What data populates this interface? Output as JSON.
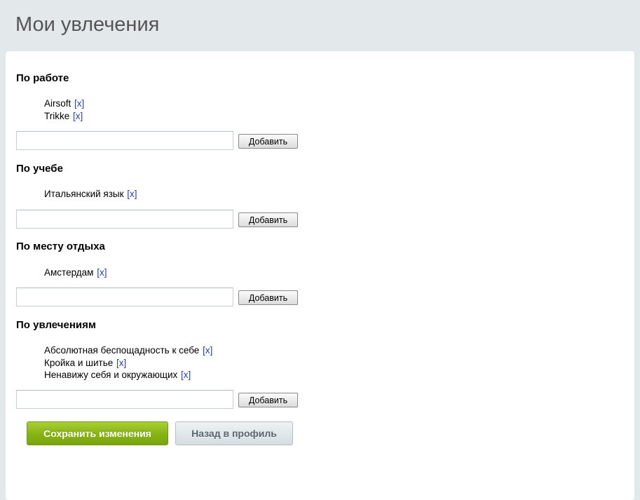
{
  "page": {
    "title": "Мои увлечения"
  },
  "sections": [
    {
      "title": "По работе",
      "items": [
        {
          "label": "Airsoft",
          "remove": "[x]"
        },
        {
          "label": "Trikke",
          "remove": "[x]"
        }
      ],
      "input_value": "",
      "add_label": "Добавить"
    },
    {
      "title": "По учебе",
      "items": [
        {
          "label": "Итальянский язык",
          "remove": "[x]"
        }
      ],
      "input_value": "",
      "add_label": "Добавить"
    },
    {
      "title": "По месту отдыха",
      "items": [
        {
          "label": "Амстердам",
          "remove": "[x]"
        }
      ],
      "input_value": "",
      "add_label": "Добавить"
    },
    {
      "title": "По увлечениям",
      "items": [
        {
          "label": "Абсолютная беспощадность к себе",
          "remove": "[x]"
        },
        {
          "label": "Кройка и шитье",
          "remove": "[x]"
        },
        {
          "label": "Ненавижу себя и окружающих",
          "remove": "[x]"
        }
      ],
      "input_value": "",
      "add_label": "Добавить"
    }
  ],
  "actions": {
    "save_label": "Сохранить изменения",
    "back_label": "Назад в профиль"
  },
  "colors": {
    "page_background": "#e3e8eb",
    "link": "#2a3cab",
    "save_button": "#86b213",
    "back_button": "#d5dde1"
  }
}
